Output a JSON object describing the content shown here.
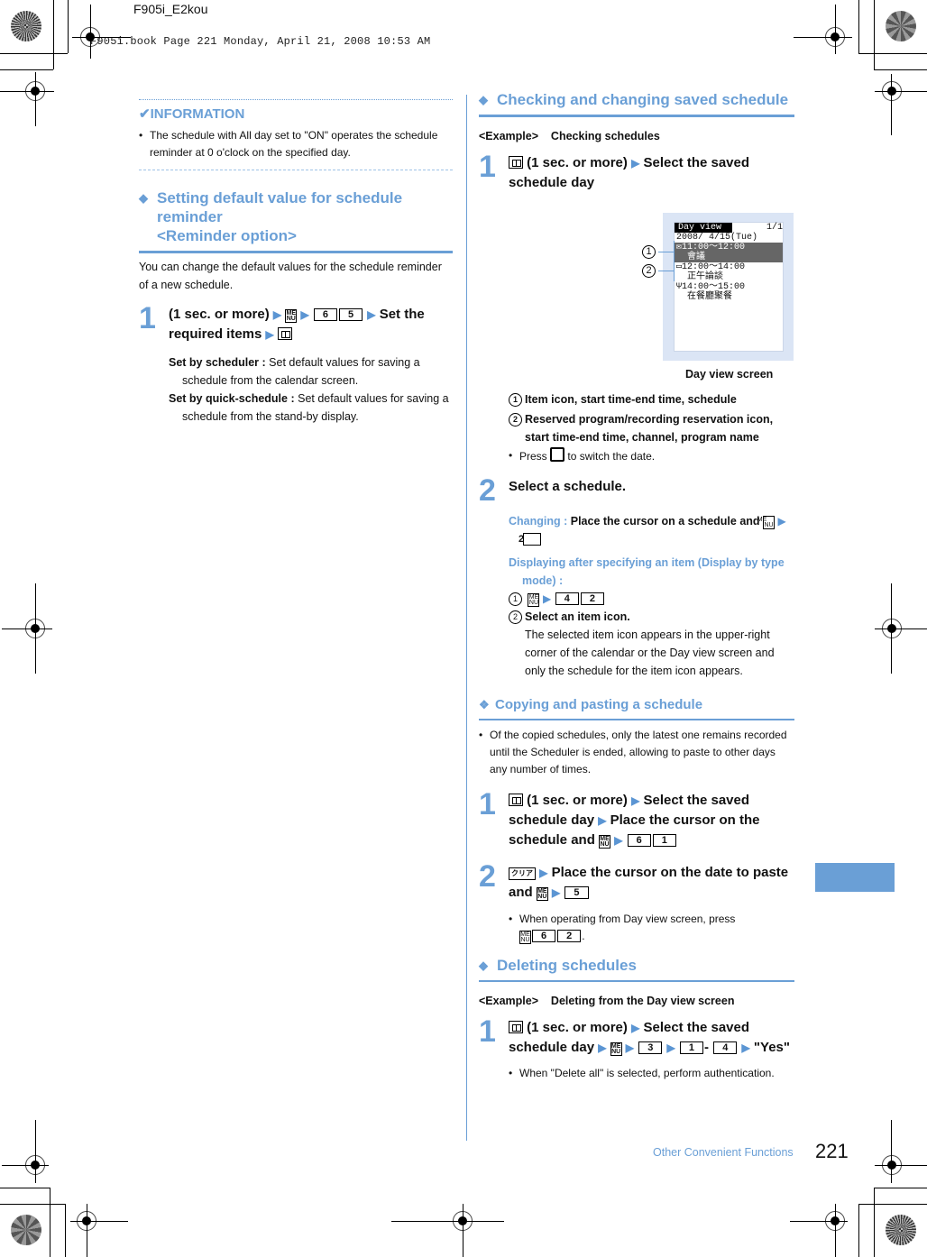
{
  "print_header": {
    "file_label": "F905i_E2kou",
    "book_info": "F905i.book  Page 221  Monday, April 21, 2008  10:53 AM"
  },
  "information": {
    "title": "INFORMATION",
    "check_icon": "check-icon",
    "bullets": [
      "The schedule with All day set to \"ON\" operates the schedule reminder at 0 o'clock on the specified day."
    ]
  },
  "reminder_section": {
    "title_line1": "Setting default value for schedule reminder",
    "title_line2": "<Reminder option>",
    "intro": "You can change the default values for the schedule reminder of a new schedule.",
    "step1": {
      "number": "1",
      "text_a": "(1 sec. or more)",
      "keys": [
        "6",
        "5"
      ],
      "text_b": "Set the required items"
    },
    "options": [
      {
        "label": "Set by scheduler :",
        "desc": "Set default values for saving a schedule from the calendar screen."
      },
      {
        "label": "Set by quick-schedule :",
        "desc": "Set default values for saving a schedule from the stand-by display."
      }
    ]
  },
  "checking_section": {
    "title": "Checking and changing saved schedule",
    "example_label": "<Example>",
    "example_text": "Checking schedules",
    "step1": {
      "number": "1",
      "text_a": "(1 sec. or more)",
      "text_b": "Select the saved schedule day"
    },
    "screen": {
      "title": "Day view",
      "page": "1/1",
      "date": "2008/ 4/15(Tue)",
      "entries": [
        {
          "time": "11:00～12:00",
          "name": "會議",
          "icon": "meeting-icon",
          "selected": true
        },
        {
          "time": "12:00～14:00",
          "name": "正午論談",
          "icon": "tv-icon",
          "selected": false
        },
        {
          "time": "14:00～15:00",
          "name": "在餐廳聚餐",
          "icon": "meal-icon",
          "selected": false
        }
      ],
      "callouts": [
        "1",
        "2"
      ],
      "caption": "Day view screen"
    },
    "legend": [
      {
        "num": "1",
        "text": "Item icon, start time-end time, schedule"
      },
      {
        "num": "2",
        "text": "Reserved program/recording reservation icon, start time-end time, channel, program name"
      }
    ],
    "press_note_a": "Press",
    "press_note_b": "to switch the date.",
    "step2": {
      "number": "2",
      "text": "Select a schedule."
    },
    "changing": {
      "label": "Changing :",
      "text": "Place the cursor on a schedule and",
      "keys": [
        "2"
      ]
    },
    "displaying": {
      "label": "Displaying after specifying an item (Display by type mode) :",
      "sub1_keys": [
        "4",
        "2"
      ],
      "sub2_title": "Select an item icon.",
      "sub2_text": "The selected item icon appears in the upper-right corner of the calendar or the Day view screen and only the schedule for the item icon appears."
    }
  },
  "copying_section": {
    "title": "Copying and pasting a schedule",
    "bullet": "Of the copied schedules, only the latest one remains recorded until the Scheduler is ended, allowing to paste to other days any number of times.",
    "step1": {
      "number": "1",
      "text_a": "(1 sec. or more)",
      "text_b": "Select the saved schedule day",
      "text_c": "Place the cursor on the schedule and",
      "keys": [
        "6",
        "1"
      ]
    },
    "step2": {
      "number": "2",
      "clear_key": "クリア",
      "text_a": "Place the cursor on the date to paste and",
      "keys": [
        "5"
      ]
    },
    "note_a": "When operating from Day view screen, press",
    "note_keys": [
      "6",
      "2"
    ]
  },
  "deleting_section": {
    "title": "Deleting schedules",
    "example_label": "<Example>",
    "example_text": "Deleting from the Day view screen",
    "step1": {
      "number": "1",
      "text_a": "(1 sec. or more)",
      "text_b": "Select the saved schedule day",
      "keys": [
        "3",
        "1",
        "4"
      ],
      "text_c": "\"Yes\""
    },
    "note": "When \"Delete all\" is selected, perform authentication."
  },
  "footer": {
    "section": "Other Convenient Functions",
    "page": "221"
  },
  "colors": {
    "accent": "#6a9fd6",
    "text": "#111111"
  }
}
